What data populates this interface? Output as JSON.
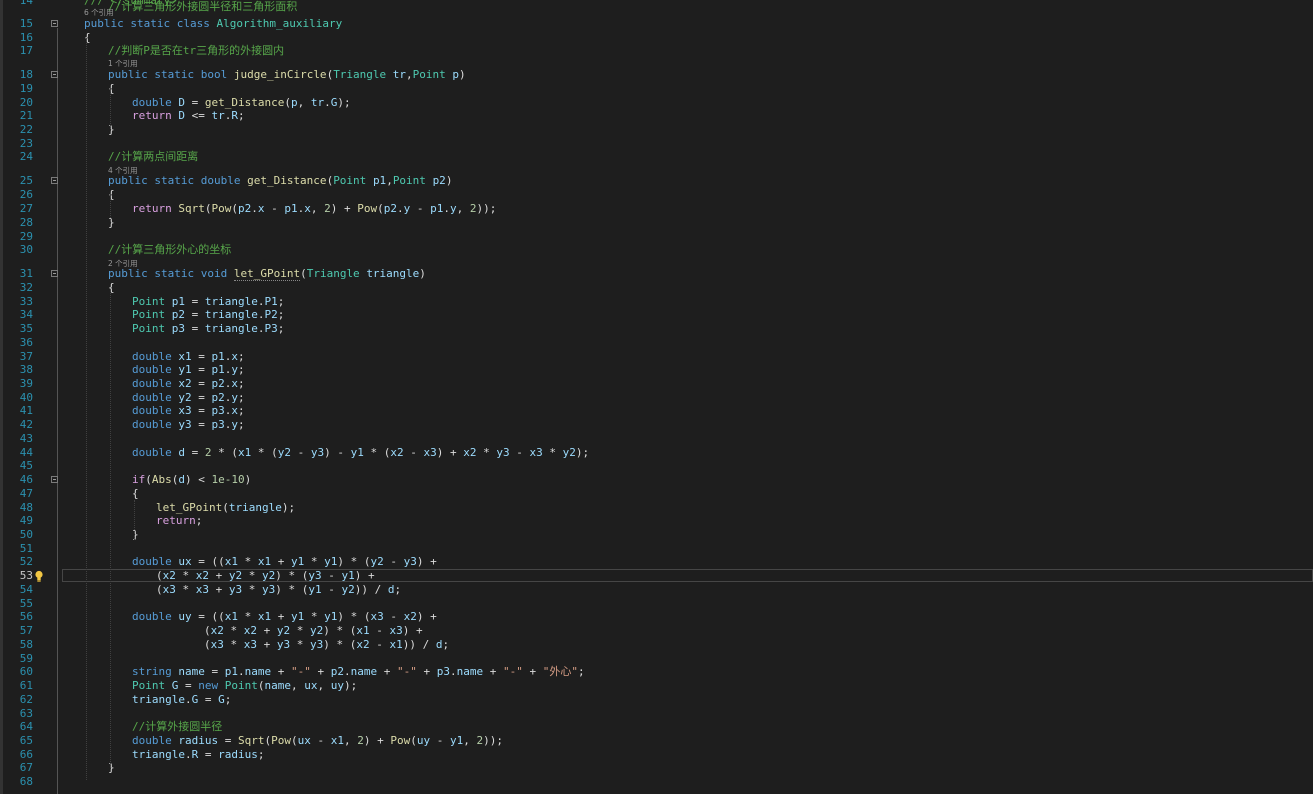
{
  "editor": {
    "line_numbers": [
      "14",
      "15",
      "16",
      "17",
      "18",
      "19",
      "20",
      "21",
      "22",
      "23",
      "24",
      "25",
      "26",
      "27",
      "28",
      "29",
      "30",
      "31",
      "32",
      "33",
      "34",
      "35",
      "36",
      "37",
      "38",
      "39",
      "40",
      "41",
      "42",
      "43",
      "44",
      "45",
      "46",
      "47",
      "48",
      "49",
      "50",
      "51",
      "52",
      "53",
      "54",
      "55",
      "56",
      "57",
      "58",
      "59",
      "60",
      "61",
      "62",
      "63",
      "64",
      "65",
      "66",
      "67",
      "68"
    ],
    "current_line": "53",
    "codelens": [
      "6 个引用",
      "1 个引用",
      "4 个引用",
      "2 个引用"
    ],
    "lines": [
      [
        [
          "cm",
          "/// </summary>"
        ]
      ],
      [
        [
          "kw",
          "public static class "
        ],
        [
          "ty",
          "Algorithm_auxiliary"
        ]
      ],
      [
        [
          "",
          "{"
        ]
      ],
      [
        [
          "cm",
          "//判断P是否在tr三角形的外接圆内"
        ]
      ],
      [
        [
          "kw",
          "public static bool "
        ],
        [
          "fn",
          "judge_inCircle"
        ],
        [
          "",
          "("
        ],
        [
          "ty",
          "Triangle "
        ],
        [
          "vr",
          "tr"
        ],
        [
          "",
          ","
        ],
        [
          "ty",
          "Point "
        ],
        [
          "vr",
          "p"
        ],
        [
          "",
          ")"
        ]
      ],
      [
        [
          "",
          "{"
        ]
      ],
      [
        [
          "kw",
          "double "
        ],
        [
          "vr",
          "D"
        ],
        [
          "",
          " = "
        ],
        [
          "fn",
          "get_Distance"
        ],
        [
          "",
          "("
        ],
        [
          "vr",
          "p"
        ],
        [
          "",
          ", "
        ],
        [
          "vr",
          "tr"
        ],
        [
          "",
          "."
        ],
        [
          "vr",
          "G"
        ],
        [
          "",
          ");"
        ]
      ],
      [
        [
          "ct",
          "return "
        ],
        [
          "vr",
          "D"
        ],
        [
          "",
          " <= "
        ],
        [
          "vr",
          "tr"
        ],
        [
          "",
          "."
        ],
        [
          "vr",
          "R"
        ],
        [
          "",
          ";"
        ]
      ],
      [
        [
          "",
          "}"
        ]
      ],
      [],
      [
        [
          "cm",
          "//计算两点间距离"
        ]
      ],
      [
        [
          "kw",
          "public static double "
        ],
        [
          "fn",
          "get_Distance"
        ],
        [
          "",
          "("
        ],
        [
          "ty",
          "Point "
        ],
        [
          "vr",
          "p1"
        ],
        [
          "",
          ","
        ],
        [
          "ty",
          "Point "
        ],
        [
          "vr",
          "p2"
        ],
        [
          "",
          ")"
        ]
      ],
      [
        [
          "",
          "{"
        ]
      ],
      [
        [
          "ct",
          "return "
        ],
        [
          "fn",
          "Sqrt"
        ],
        [
          "",
          "("
        ],
        [
          "fn",
          "Pow"
        ],
        [
          "",
          "("
        ],
        [
          "vr",
          "p2"
        ],
        [
          "",
          "."
        ],
        [
          "vr",
          "x"
        ],
        [
          "",
          " - "
        ],
        [
          "vr",
          "p1"
        ],
        [
          "",
          "."
        ],
        [
          "vr",
          "x"
        ],
        [
          "",
          ", "
        ],
        [
          "nm",
          "2"
        ],
        [
          "",
          ") + "
        ],
        [
          "fn",
          "Pow"
        ],
        [
          "",
          "("
        ],
        [
          "vr",
          "p2"
        ],
        [
          "",
          "."
        ],
        [
          "vr",
          "y"
        ],
        [
          "",
          " - "
        ],
        [
          "vr",
          "p1"
        ],
        [
          "",
          "."
        ],
        [
          "vr",
          "y"
        ],
        [
          "",
          ", "
        ],
        [
          "nm",
          "2"
        ],
        [
          "",
          "));"
        ]
      ],
      [
        [
          "",
          "}"
        ]
      ],
      [],
      [
        [
          "cm",
          "//计算三角形外心的坐标"
        ]
      ],
      [
        [
          "kw",
          "public static void "
        ],
        [
          "fn sq",
          "let_GPoint"
        ],
        [
          "",
          "("
        ],
        [
          "ty",
          "Triangle "
        ],
        [
          "vr",
          "triangle"
        ],
        [
          "",
          ")"
        ]
      ],
      [
        [
          "",
          "{"
        ]
      ],
      [
        [
          "ty",
          "Point "
        ],
        [
          "vr",
          "p1"
        ],
        [
          "",
          " = "
        ],
        [
          "vr",
          "triangle"
        ],
        [
          "",
          "."
        ],
        [
          "vr",
          "P1"
        ],
        [
          "",
          ";"
        ]
      ],
      [
        [
          "ty",
          "Point "
        ],
        [
          "vr",
          "p2"
        ],
        [
          "",
          " = "
        ],
        [
          "vr",
          "triangle"
        ],
        [
          "",
          "."
        ],
        [
          "vr",
          "P2"
        ],
        [
          "",
          ";"
        ]
      ],
      [
        [
          "ty",
          "Point "
        ],
        [
          "vr",
          "p3"
        ],
        [
          "",
          " = "
        ],
        [
          "vr",
          "triangle"
        ],
        [
          "",
          "."
        ],
        [
          "vr",
          "P3"
        ],
        [
          "",
          ";"
        ]
      ],
      [],
      [
        [
          "kw",
          "double "
        ],
        [
          "vr",
          "x1"
        ],
        [
          "",
          " = "
        ],
        [
          "vr",
          "p1"
        ],
        [
          "",
          "."
        ],
        [
          "vr",
          "x"
        ],
        [
          "",
          ";"
        ]
      ],
      [
        [
          "kw",
          "double "
        ],
        [
          "vr",
          "y1"
        ],
        [
          "",
          " = "
        ],
        [
          "vr",
          "p1"
        ],
        [
          "",
          "."
        ],
        [
          "vr",
          "y"
        ],
        [
          "",
          ";"
        ]
      ],
      [
        [
          "kw",
          "double "
        ],
        [
          "vr",
          "x2"
        ],
        [
          "",
          " = "
        ],
        [
          "vr",
          "p2"
        ],
        [
          "",
          "."
        ],
        [
          "vr",
          "x"
        ],
        [
          "",
          ";"
        ]
      ],
      [
        [
          "kw",
          "double "
        ],
        [
          "vr",
          "y2"
        ],
        [
          "",
          " = "
        ],
        [
          "vr",
          "p2"
        ],
        [
          "",
          "."
        ],
        [
          "vr",
          "y"
        ],
        [
          "",
          ";"
        ]
      ],
      [
        [
          "kw",
          "double "
        ],
        [
          "vr",
          "x3"
        ],
        [
          "",
          " = "
        ],
        [
          "vr",
          "p3"
        ],
        [
          "",
          "."
        ],
        [
          "vr",
          "x"
        ],
        [
          "",
          ";"
        ]
      ],
      [
        [
          "kw",
          "double "
        ],
        [
          "vr",
          "y3"
        ],
        [
          "",
          " = "
        ],
        [
          "vr",
          "p3"
        ],
        [
          "",
          "."
        ],
        [
          "vr",
          "y"
        ],
        [
          "",
          ";"
        ]
      ],
      [],
      [
        [
          "kw",
          "double "
        ],
        [
          "vr",
          "d"
        ],
        [
          "",
          " = "
        ],
        [
          "nm",
          "2"
        ],
        [
          "",
          " * ("
        ],
        [
          "vr",
          "x1"
        ],
        [
          "",
          " * ("
        ],
        [
          "vr",
          "y2"
        ],
        [
          "",
          " - "
        ],
        [
          "vr",
          "y3"
        ],
        [
          "",
          ") - "
        ],
        [
          "vr",
          "y1"
        ],
        [
          "",
          " * ("
        ],
        [
          "vr",
          "x2"
        ],
        [
          "",
          " - "
        ],
        [
          "vr",
          "x3"
        ],
        [
          "",
          ") + "
        ],
        [
          "vr",
          "x2"
        ],
        [
          "",
          " * "
        ],
        [
          "vr",
          "y3"
        ],
        [
          "",
          " - "
        ],
        [
          "vr",
          "x3"
        ],
        [
          "",
          " * "
        ],
        [
          "vr",
          "y2"
        ],
        [
          "",
          ");"
        ]
      ],
      [],
      [
        [
          "ct",
          "if"
        ],
        [
          "",
          "("
        ],
        [
          "fn",
          "Abs"
        ],
        [
          "",
          "("
        ],
        [
          "vr",
          "d"
        ],
        [
          "",
          ") < "
        ],
        [
          "nm",
          "1e-10"
        ],
        [
          "",
          ")"
        ]
      ],
      [
        [
          "",
          "{"
        ]
      ],
      [
        [
          "fn",
          "let_GPoint"
        ],
        [
          "",
          "("
        ],
        [
          "vr",
          "triangle"
        ],
        [
          "",
          ");"
        ]
      ],
      [
        [
          "ct",
          "return"
        ],
        [
          "",
          ";"
        ]
      ],
      [
        [
          "",
          "}"
        ]
      ],
      [],
      [
        [
          "kw",
          "double "
        ],
        [
          "vr",
          "ux"
        ],
        [
          "",
          " = (("
        ],
        [
          "vr",
          "x1"
        ],
        [
          "",
          " * "
        ],
        [
          "vr",
          "x1"
        ],
        [
          "",
          " + "
        ],
        [
          "vr",
          "y1"
        ],
        [
          "",
          " * "
        ],
        [
          "vr",
          "y1"
        ],
        [
          "",
          ") * ("
        ],
        [
          "vr",
          "y2"
        ],
        [
          "",
          " - "
        ],
        [
          "vr",
          "y3"
        ],
        [
          "",
          ") +"
        ]
      ],
      [
        [
          "",
          "("
        ],
        [
          "vr",
          "x2"
        ],
        [
          "",
          " * "
        ],
        [
          "vr",
          "x2"
        ],
        [
          "",
          " + "
        ],
        [
          "vr",
          "y2"
        ],
        [
          "",
          " * "
        ],
        [
          "vr",
          "y2"
        ],
        [
          "",
          ") * ("
        ],
        [
          "vr",
          "y3"
        ],
        [
          "",
          " - "
        ],
        [
          "vr",
          "y1"
        ],
        [
          "",
          ") +"
        ]
      ],
      [
        [
          "",
          "("
        ],
        [
          "vr",
          "x3"
        ],
        [
          "",
          " * "
        ],
        [
          "vr",
          "x3"
        ],
        [
          "",
          " + "
        ],
        [
          "vr",
          "y3"
        ],
        [
          "",
          " * "
        ],
        [
          "vr",
          "y3"
        ],
        [
          "",
          ") * ("
        ],
        [
          "vr",
          "y1"
        ],
        [
          "",
          " - "
        ],
        [
          "vr",
          "y2"
        ],
        [
          "",
          ")) / "
        ],
        [
          "vr",
          "d"
        ],
        [
          "",
          ";"
        ]
      ],
      [],
      [
        [
          "kw",
          "double "
        ],
        [
          "vr",
          "uy"
        ],
        [
          "",
          " = (("
        ],
        [
          "vr",
          "x1"
        ],
        [
          "",
          " * "
        ],
        [
          "vr",
          "x1"
        ],
        [
          "",
          " + "
        ],
        [
          "vr",
          "y1"
        ],
        [
          "",
          " * "
        ],
        [
          "vr",
          "y1"
        ],
        [
          "",
          ") * ("
        ],
        [
          "vr",
          "x3"
        ],
        [
          "",
          " - "
        ],
        [
          "vr",
          "x2"
        ],
        [
          "",
          ") +"
        ]
      ],
      [
        [
          "",
          "("
        ],
        [
          "vr",
          "x2"
        ],
        [
          "",
          " * "
        ],
        [
          "vr",
          "x2"
        ],
        [
          "",
          " + "
        ],
        [
          "vr",
          "y2"
        ],
        [
          "",
          " * "
        ],
        [
          "vr",
          "y2"
        ],
        [
          "",
          ") * ("
        ],
        [
          "vr",
          "x1"
        ],
        [
          "",
          " - "
        ],
        [
          "vr",
          "x3"
        ],
        [
          "",
          ") +"
        ]
      ],
      [
        [
          "",
          "("
        ],
        [
          "vr",
          "x3"
        ],
        [
          "",
          " * "
        ],
        [
          "vr",
          "x3"
        ],
        [
          "",
          " + "
        ],
        [
          "vr",
          "y3"
        ],
        [
          "",
          " * "
        ],
        [
          "vr",
          "y3"
        ],
        [
          "",
          ") * ("
        ],
        [
          "vr",
          "x2"
        ],
        [
          "",
          " - "
        ],
        [
          "vr",
          "x1"
        ],
        [
          "",
          ")) / "
        ],
        [
          "vr",
          "d"
        ],
        [
          "",
          ";"
        ]
      ],
      [],
      [
        [
          "kw",
          "string "
        ],
        [
          "vr",
          "name"
        ],
        [
          "",
          " = "
        ],
        [
          "vr",
          "p1"
        ],
        [
          "",
          "."
        ],
        [
          "vr",
          "name"
        ],
        [
          "",
          " + "
        ],
        [
          "st",
          "\"-\""
        ],
        [
          "",
          " + "
        ],
        [
          "vr",
          "p2"
        ],
        [
          "",
          "."
        ],
        [
          "vr",
          "name"
        ],
        [
          "",
          " + "
        ],
        [
          "st",
          "\"-\""
        ],
        [
          "",
          " + "
        ],
        [
          "vr",
          "p3"
        ],
        [
          "",
          "."
        ],
        [
          "vr",
          "name"
        ],
        [
          "",
          " + "
        ],
        [
          "st",
          "\"-\""
        ],
        [
          "",
          " + "
        ],
        [
          "st",
          "\"外心\""
        ],
        [
          "",
          ";"
        ]
      ],
      [
        [
          "ty",
          "Point "
        ],
        [
          "vr",
          "G"
        ],
        [
          "",
          " = "
        ],
        [
          "kw",
          "new "
        ],
        [
          "ty",
          "Point"
        ],
        [
          "",
          "("
        ],
        [
          "vr",
          "name"
        ],
        [
          "",
          ", "
        ],
        [
          "vr",
          "ux"
        ],
        [
          "",
          ", "
        ],
        [
          "vr",
          "uy"
        ],
        [
          "",
          ");"
        ]
      ],
      [
        [
          "vr",
          "triangle"
        ],
        [
          "",
          "."
        ],
        [
          "vr",
          "G"
        ],
        [
          "",
          " = "
        ],
        [
          "vr",
          "G"
        ],
        [
          "",
          ";"
        ]
      ],
      [],
      [
        [
          "cm",
          "//计算外接圆半径"
        ]
      ],
      [
        [
          "kw",
          "double "
        ],
        [
          "vr",
          "radius"
        ],
        [
          "",
          " = "
        ],
        [
          "fn",
          "Sqrt"
        ],
        [
          "",
          "("
        ],
        [
          "fn",
          "Pow"
        ],
        [
          "",
          "("
        ],
        [
          "vr",
          "ux"
        ],
        [
          "",
          " - "
        ],
        [
          "vr",
          "x1"
        ],
        [
          "",
          ", "
        ],
        [
          "nm",
          "2"
        ],
        [
          "",
          ") + "
        ],
        [
          "fn",
          "Pow"
        ],
        [
          "",
          "("
        ],
        [
          "vr",
          "uy"
        ],
        [
          "",
          " - "
        ],
        [
          "vr",
          "y1"
        ],
        [
          "",
          ", "
        ],
        [
          "nm",
          "2"
        ],
        [
          "",
          "));"
        ]
      ],
      [
        [
          "vr",
          "triangle"
        ],
        [
          "",
          "."
        ],
        [
          "vr",
          "R"
        ],
        [
          "",
          " = "
        ],
        [
          "vr",
          "radius"
        ],
        [
          "",
          ";"
        ]
      ],
      [
        [
          "",
          "}"
        ]
      ],
      [],
      [
        [
          "cm",
          "//计算三角形外接圆半径和三角形面积"
        ]
      ]
    ]
  }
}
